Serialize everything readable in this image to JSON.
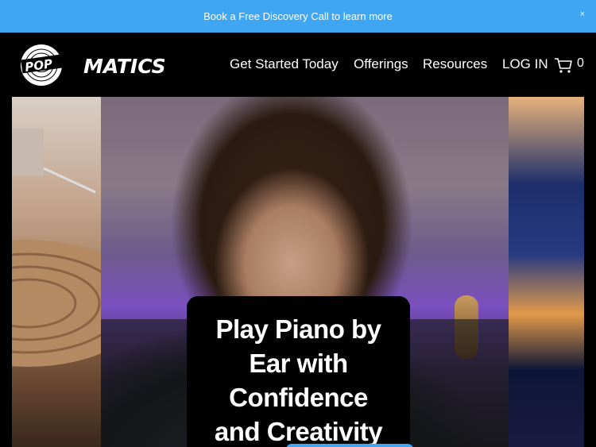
{
  "announcement": {
    "text": "Book a Free Discovery Call to learn more",
    "close": "×"
  },
  "header": {
    "logo": {
      "text_pop": "POP",
      "text_rest": "MATICS"
    },
    "nav": [
      {
        "label": "Get Started Today"
      },
      {
        "label": "Offerings"
      },
      {
        "label": "Resources"
      },
      {
        "label": "LOG IN"
      }
    ],
    "cart_count": "0",
    "cart_icon": "cart-icon"
  },
  "hero": {
    "headline_lines": [
      "Play Piano by",
      "Ear with",
      "Confidence",
      "and Creativity"
    ]
  },
  "colors": {
    "accent": "#3ea6f2",
    "background": "#000000",
    "text": "#ffffff"
  }
}
